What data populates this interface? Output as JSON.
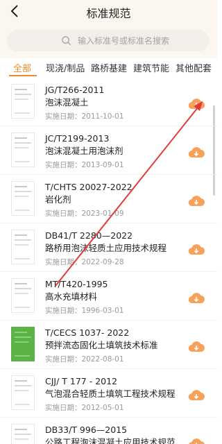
{
  "header": {
    "title": "标准规范",
    "back_icon": "chevron-left-icon"
  },
  "search": {
    "placeholder": "输入标准号或标准名搜索",
    "icon": "search-icon"
  },
  "tabs": [
    {
      "label": "全部",
      "active": true
    },
    {
      "label": "现浇/制品",
      "active": false
    },
    {
      "label": "路桥基建",
      "active": false
    },
    {
      "label": "建筑节能",
      "active": false
    },
    {
      "label": "其他配套",
      "active": false
    }
  ],
  "colors": {
    "accent": "#f08a24",
    "header_bg": "#fbf6ef",
    "download": "#f7a25a",
    "annotation_arrow": "#e53935"
  },
  "items": [
    {
      "code": "JG/T266-2011",
      "name": "泡沫混凝土",
      "date": "实施日期：2011-10-01",
      "thumb": "document-cover"
    },
    {
      "code": "JC/T2199-2013",
      "name": "泡沫混凝土用泡沫剂",
      "date": "实施日期：2013-09-01",
      "thumb": "document-cover"
    },
    {
      "code": "T/CHTS 20027-2022",
      "name": "岩化剂",
      "date": "实施日期：2023-01-09",
      "thumb": "document-cover"
    },
    {
      "code": "DB41/T 2280—2022",
      "name": "路桥用泡沫轻质土应用技术规程",
      "date": "实施日期：2022-09-28",
      "thumb": "document-cover"
    },
    {
      "code": "MT/T420-1995",
      "name": "高水充填材料",
      "date": "实施日期：1996-03-01",
      "thumb": "document-cover"
    },
    {
      "code": "T/CECS 1037- 2022",
      "name": "预拌流态固化土填筑技术标准",
      "date": "实施日期：2022-08-01",
      "thumb": "green-document-cover"
    },
    {
      "code": "CJJ/ T 177 - 2012",
      "name": "气泡混合轻质土填筑工程技术规程",
      "date": "实施日期：2012-05-01",
      "thumb": "document-cover"
    },
    {
      "code": "DB33/T 996—2015",
      "name": "公路工程泡沫混凝土应用技术规范",
      "date": "",
      "thumb": "document-cover"
    }
  ]
}
